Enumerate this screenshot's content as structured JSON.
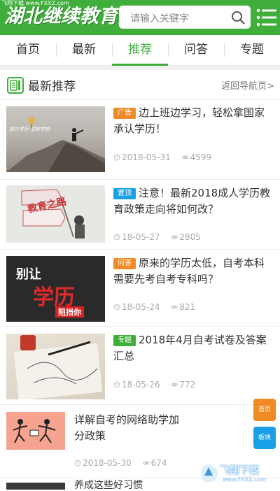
{
  "header": {
    "watermark_top": "飞翔下载 www.FXXZ.com",
    "logo": "湖北继续教育网",
    "search_placeholder": "请输入关键字"
  },
  "tabs": [
    {
      "label": "首页",
      "active": false
    },
    {
      "label": "最新",
      "active": false
    },
    {
      "label": "推荐",
      "active": true
    },
    {
      "label": "问答",
      "active": false
    },
    {
      "label": "专题",
      "active": false
    }
  ],
  "section": {
    "title": "最新推荐",
    "back_link": "返回导航页>"
  },
  "articles": [
    {
      "tag": "广告",
      "tag_color": "#f08a24",
      "title": "边上班边学习，轻松拿国家承认学历！",
      "date": "2018-05-31",
      "views": "4599",
      "thumb_caption": "提升学历 成就梦想"
    },
    {
      "tag": "置顶",
      "tag_color": "#1aa0e6",
      "title": "注意！最新2018成人学历教育政策走向将如何改？",
      "date": "18-05-27",
      "views": "2805",
      "thumb_caption": "教育之路"
    },
    {
      "tag": "问答",
      "tag_color": "#f08a24",
      "title": "原来的学历太低，自考本科需要先考自考专科吗？",
      "date": "18-05-24",
      "views": "821",
      "thumb_caption_1": "别让",
      "thumb_caption_2": "学历",
      "thumb_caption_3": "阻挡你"
    },
    {
      "tag": "专题",
      "tag_color": "#3fae3a",
      "title": "2018年4月自考试卷及答案汇总",
      "date": "18-05-26",
      "views": "772"
    },
    {
      "tag": "",
      "title": "详解自考的网络助学加分政策",
      "date": "2018-05-30",
      "views": "674"
    },
    {
      "tag": "",
      "title": "养成这些好习惯"
    }
  ],
  "float_buttons": {
    "home": "首页",
    "section": "板块"
  },
  "bottom_watermark": {
    "name": "飞翔下载",
    "url": "www.FXXZ.com"
  }
}
